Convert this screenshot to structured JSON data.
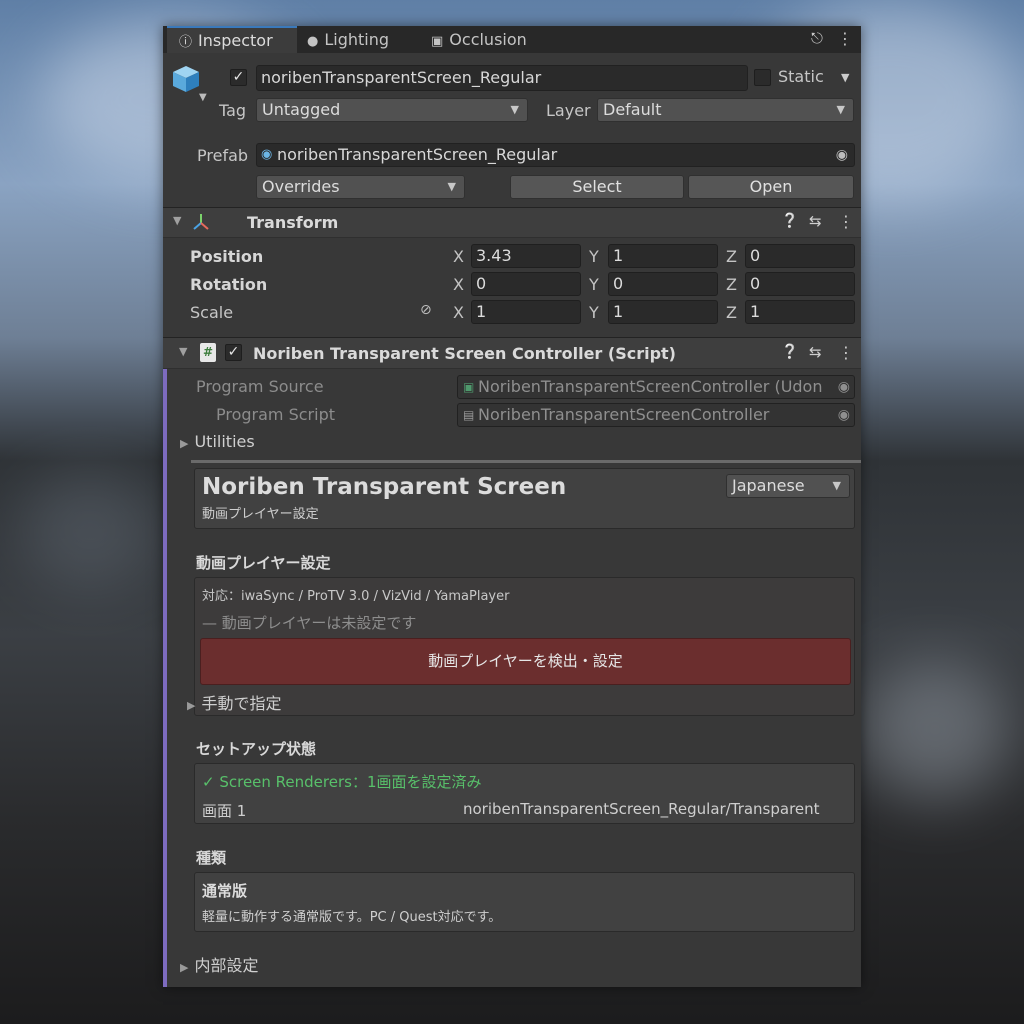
{
  "tabs": [
    {
      "label": "Inspector",
      "icon": "info-icon",
      "active": true
    },
    {
      "label": "Lighting",
      "icon": "lightbulb-icon",
      "active": false
    },
    {
      "label": "Occlusion",
      "icon": "occlusion-icon",
      "active": false
    }
  ],
  "object": {
    "enabled": true,
    "name": "noribenTransparentScreen_Regular",
    "static_label": "Static",
    "tag_label": "Tag",
    "tag_value": "Untagged",
    "layer_label": "Layer",
    "layer_value": "Default",
    "prefab_label": "Prefab",
    "prefab_value": "noribenTransparentScreen_Regular",
    "overrides_label": "Overrides",
    "select_label": "Select",
    "open_label": "Open"
  },
  "transform": {
    "title": "Transform",
    "rows": [
      {
        "label": "Position",
        "x": "3.43",
        "y": "1",
        "z": "0"
      },
      {
        "label": "Rotation",
        "x": "0",
        "y": "0",
        "z": "0"
      },
      {
        "label": "Scale",
        "x": "1",
        "y": "1",
        "z": "1"
      }
    ],
    "axis_x": "X",
    "axis_y": "Y",
    "axis_z": "Z"
  },
  "script": {
    "title": "Noriben Transparent Screen Controller (Script)",
    "program_source_label": "Program Source",
    "program_source_value": "NoribenTransparentScreenController (Udon",
    "program_script_label": "Program Script",
    "program_script_value": "NoribenTransparentScreenController",
    "utilities_label": "Utilities"
  },
  "custom": {
    "title": "Noriben Transparent Screen",
    "subtitle": "動画プレイヤー設定",
    "language": "Japanese",
    "video_section_title": "動画プレイヤー設定",
    "supported": "対応：iwaSync / ProTV 3.0 / VizVid / YamaPlayer",
    "not_set": "— 動画プレイヤーは未設定です",
    "detect_button": "動画プレイヤーを検出・設定",
    "manual_label": "手動で指定",
    "setup_section_title": "セットアップ状態",
    "renderers_status": "✓ Screen Renderers：1画面を設定済み",
    "screen_label": "画面 1",
    "screen_value": "noribenTransparentScreen_Regular/Transparent",
    "type_section_title": "種類",
    "type_name": "通常版",
    "type_desc": "軽量に動作する通常版です。PC / Quest対応です。",
    "internal_label": "内部設定"
  },
  "colors": {
    "accent": "#3a79bb",
    "danger_button": "#6b2e2e",
    "ok_green": "#58c06a",
    "script_bar": "#7d6bbf"
  }
}
